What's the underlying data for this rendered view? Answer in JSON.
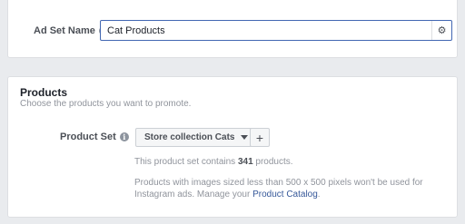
{
  "ad_set": {
    "label": "Ad Set Name",
    "info_icon": "i",
    "name_value": "Cat Products",
    "settings_icon": "gear-icon"
  },
  "products": {
    "title": "Products",
    "subtitle": "Choose the products you want to promote.",
    "product_set_label": "Product Set",
    "info_icon": "i",
    "selected_set": "Store collection Cats",
    "add_label": "+",
    "count_prefix": "This product set contains ",
    "count_value": "341",
    "count_suffix": " products.",
    "note_text": "Products with images sized less than 500 x 500 pixels won't be used for Instagram ads. Manage your ",
    "note_link": "Product Catalog",
    "note_end": "."
  },
  "colors": {
    "accent": "#4267b2",
    "link": "#365899",
    "background": "#e9ebee"
  }
}
